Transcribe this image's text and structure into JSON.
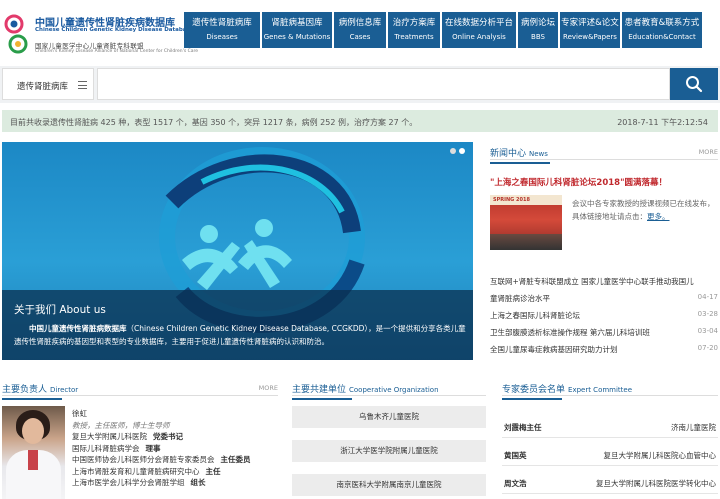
{
  "header": {
    "logo_cn": "中国儿童遗传性肾脏疾病数据库",
    "logo_en": "Chinese Children Genetic Kidney Disease Database",
    "logo_sub_cn": "国家儿童医学中心儿童肾脏专科联盟",
    "logo_sub_en": "Children's Kidney Disease Alliance of National Center for Children's Care"
  },
  "nav": [
    {
      "cn": "遗传性肾脏病库",
      "en": "Diseases",
      "width": 76
    },
    {
      "cn": "肾脏病基因库",
      "en": "Genes & Mutations",
      "width": 70
    },
    {
      "cn": "病例信息库",
      "en": "Cases",
      "width": 52
    },
    {
      "cn": "治疗方案库",
      "en": "Treatments",
      "width": 52
    },
    {
      "cn": "在线数据分析平台",
      "en": "Online Analysis",
      "width": 74
    },
    {
      "cn": "病例论坛",
      "en": "BBS",
      "width": 40
    },
    {
      "cn": "专家评述&论文",
      "en": "Review&Papers",
      "width": 60
    },
    {
      "cn": "患者教育&联系方式",
      "en": "Education&Contact",
      "width": 80
    }
  ],
  "search": {
    "category": "遗传肾脏病库",
    "placeholder": ""
  },
  "stats": {
    "text": "目前共收录遗传性肾脏病 425 种，表型 1517 个，基因 350 个，突异 1217 条，病例 252 例，治疗方案 27 个。",
    "datetime": "2018-7-11 下午2:12:54"
  },
  "banner": {
    "about_title": "关于我们 About us",
    "about_bold": "中国儿童遗传性肾脏病数据库",
    "about_text": "（Chinese Children Genetic Kidney Disease Database, CCGKDD），是一个提供和分享各类儿童遗传性肾脏疾病的基因型和表型的专业数据库，主要用于促进儿童遗传性肾脏病的认识和防治。",
    "slide_count": 2
  },
  "news": {
    "title_cn": "新闻中心",
    "title_en": "News",
    "more": "MORE",
    "headline": "\"上海之春国际儿科肾脏论坛2018\"圆满落幕！",
    "image_caption": "SPRING 2018",
    "summary": "会议中各专家教授的授课视频已在线发布，具体链接地址请点击：",
    "summary_link": "更多。",
    "items": [
      {
        "title": "互联网+肾脏专科联盟成立 国家儿童医学中心联手推动我国儿",
        "date": ""
      },
      {
        "title": "童肾脏病诊治水平",
        "date": "04-17"
      },
      {
        "title": "上海之春国际儿科肾脏论坛",
        "date": "03-28"
      },
      {
        "title": "卫生部腹膜透析标准操作规程 第六届儿科培训班",
        "date": "03-04"
      },
      {
        "title": "全国儿童尿毒症救病基因研究助力计划",
        "date": "07-20"
      }
    ]
  },
  "director": {
    "title_cn": "主要负责人",
    "title_en": "Director",
    "more": "MORE",
    "name": "徐虹",
    "rank": "教授，主任医师，博士生导师",
    "lines": [
      {
        "text": "复旦大学附属儿科医院",
        "role": "党委书记"
      },
      {
        "text": "国际儿科肾脏病学会",
        "role": "理事"
      },
      {
        "text": "中国医师协会儿科医师分会肾脏专家委员会",
        "role": "主任委员"
      },
      {
        "text": "上海市肾脏发育和儿童肾脏病研究中心",
        "role": "主任"
      },
      {
        "text": "上海市医学会儿科学分会肾脏学组",
        "role": "组长"
      }
    ]
  },
  "organizations": {
    "title_cn": "主要共建单位",
    "title_en": "Cooperative Organization",
    "items": [
      "乌鲁木齐儿童医院",
      "浙江大学医学院附属儿童医院",
      "南京医科大学附属南京儿童医院"
    ]
  },
  "committee": {
    "title_cn": "专家委员会名单",
    "title_en": "Expert Committee",
    "items": [
      {
        "name": "刘霞梅主任",
        "hospital": "济南儿童医院"
      },
      {
        "name": "黄国英",
        "hospital": "复旦大学附属儿科医院心血管中心"
      },
      {
        "name": "周文浩",
        "hospital": "复旦大学附属儿科医院医学转化中心"
      }
    ]
  }
}
